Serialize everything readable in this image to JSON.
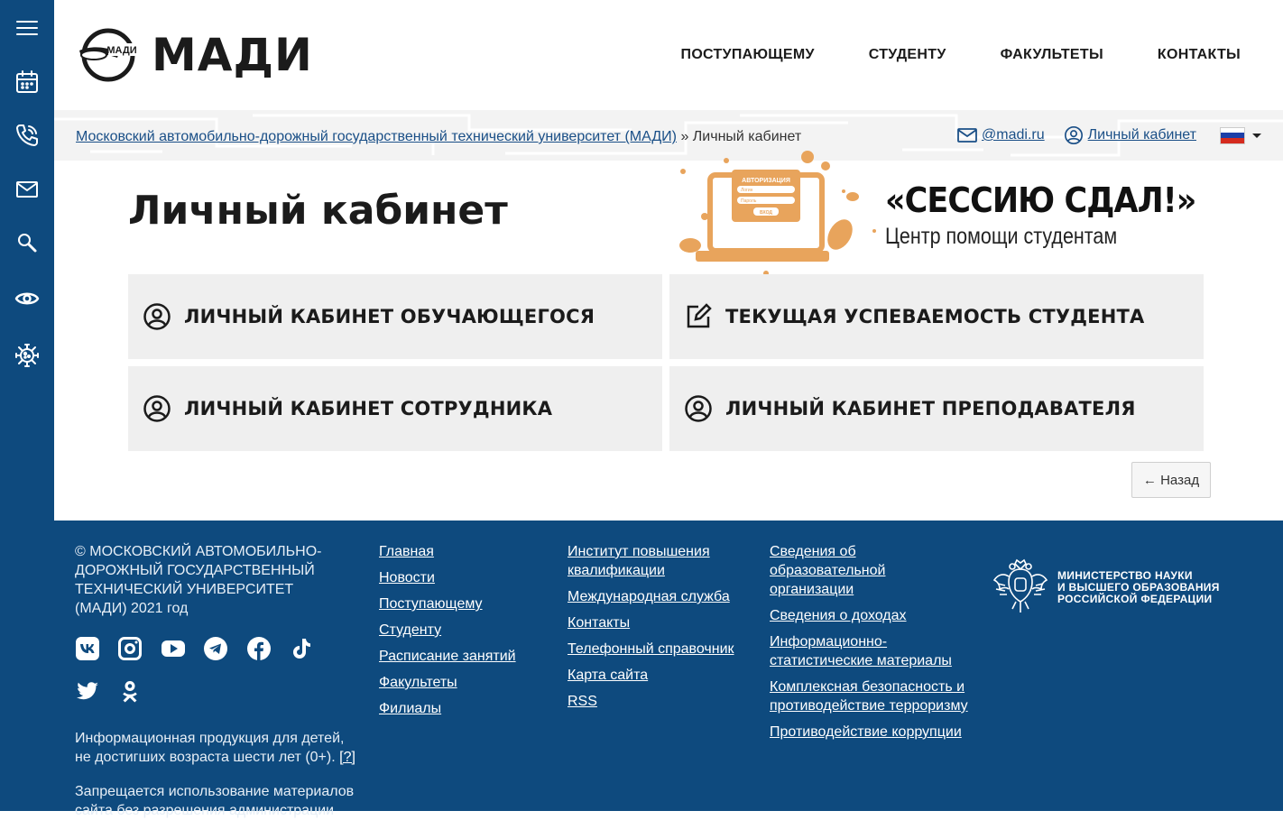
{
  "sidebar": {
    "items": [
      "menu-icon",
      "calendar-icon",
      "phone-icon",
      "mail-icon",
      "search-icon",
      "eye-icon",
      "virus-icon"
    ]
  },
  "header": {
    "logo_text": "МАДИ",
    "logo_badge": "МАДИ",
    "nav": [
      "ПОСТУПАЮЩЕМУ",
      "СТУДЕНТУ",
      "ФАКУЛЬТЕТЫ",
      "КОНТАКТЫ"
    ]
  },
  "breadcrumb": {
    "home": "Московский автомобильно-дорожный государственный технический университет (МАДИ)",
    "separator": "»",
    "current": "Личный кабинет"
  },
  "util": {
    "email": "@madi.ru",
    "cabinet": "Личный кабинет",
    "language": "RU"
  },
  "main": {
    "title": "Личный кабинет",
    "promo": {
      "title": "«СЕССИЮ СДАЛ!»",
      "subtitle": "Центр помощи студентам",
      "card_title": "АВТОРИЗАЦИЯ",
      "card_field1": "Логин",
      "card_field2": "Пароль",
      "card_button": "ВХОД"
    },
    "tiles": [
      {
        "label": "ЛИЧНЫЙ КАБИНЕТ ОБУЧАЮЩЕГОСЯ",
        "icon": "user-circle-icon"
      },
      {
        "label": "ТЕКУЩАЯ УСПЕВАЕМОСТЬ СТУДЕНТА",
        "icon": "edit-icon"
      },
      {
        "label": "ЛИЧНЫЙ КАБИНЕТ СОТРУДНИКА",
        "icon": "user-circle-icon"
      },
      {
        "label": "ЛИЧНЫЙ КАБИНЕТ ПРЕПОДАВАТЕЛЯ",
        "icon": "user-circle-icon"
      }
    ],
    "back_label": "← Назад"
  },
  "footer": {
    "copyright": "© МОСКОВСКИЙ АВТОМОБИЛЬНО-ДОРОЖНЫЙ ГОСУДАРСТВЕННЫЙ ТЕХНИЧЕСКИЙ УНИВЕРСИТЕТ (МАДИ) 2021 год",
    "social": [
      "vk-icon",
      "instagram-icon",
      "youtube-icon",
      "telegram-icon",
      "facebook-icon",
      "tiktok-icon",
      "twitter-icon",
      "odnoklassniki-icon"
    ],
    "age_notice": "Информационная продукция для детей, не достигших возраста шести лет (0+).",
    "age_link": "[?]",
    "restriction": "Запрещается использование материалов сайта без разрешения администрации",
    "col1": [
      "Главная",
      "Новости",
      "Поступающему",
      "Студенту",
      "Расписание занятий",
      "Факультеты",
      "Филиалы"
    ],
    "col2": [
      "Институт повышения квалификации",
      "Международная служба",
      "Контакты",
      "Телефонный справочник",
      "Карта сайта",
      "RSS"
    ],
    "col3": [
      "Сведения об образовательной организации",
      "Сведения о доходах",
      "Информационно-статистические материалы",
      "Комплексная безопасность и противодействие терроризму",
      "Противодействие коррупции"
    ],
    "ministry": [
      "МИНИСТЕРСТВО НАУКИ",
      "И ВЫСШЕГО ОБРАЗОВАНИЯ",
      "РОССИЙСКОЙ ФЕДЕРАЦИИ"
    ]
  },
  "colors": {
    "brand_blue": "#0e4a7e",
    "link": "#1a4f87",
    "tile_bg": "#efefef",
    "promo_orange": "#e8a45c"
  }
}
